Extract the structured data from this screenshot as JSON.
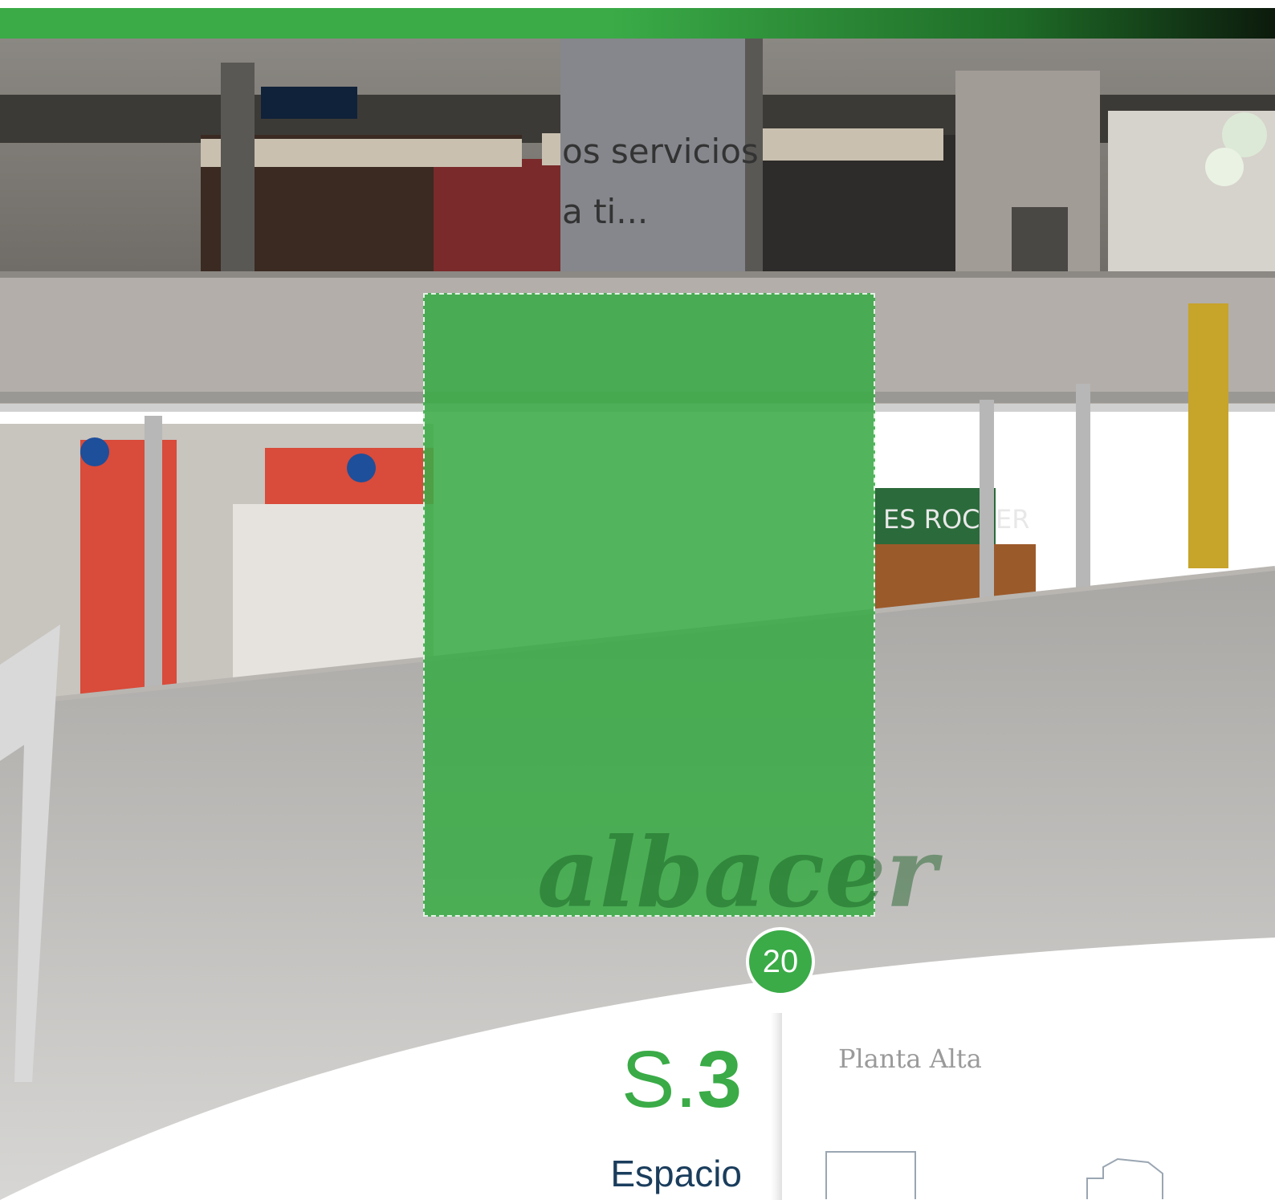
{
  "header": {
    "bar_colors": [
      "#3aab47",
      "#1e6b27",
      "#0c1a0c"
    ]
  },
  "photo": {
    "description_icon": "shopping-mall-photo",
    "signs": {
      "pillar_line1": "os servicios",
      "pillar_line2": "a ti...",
      "store_sign": "ES ROC ER"
    }
  },
  "ad_zone": {
    "color": "#3aab47",
    "watermark": "albacer"
  },
  "page": {
    "number": "20"
  },
  "space": {
    "code_prefix": "S.",
    "code_number": "3",
    "name": "Espacio"
  },
  "floor": {
    "label": "Planta Alta"
  },
  "colors": {
    "accent": "#3aab47",
    "navy": "#1a3d5c",
    "gray": "#9a9a9a"
  }
}
